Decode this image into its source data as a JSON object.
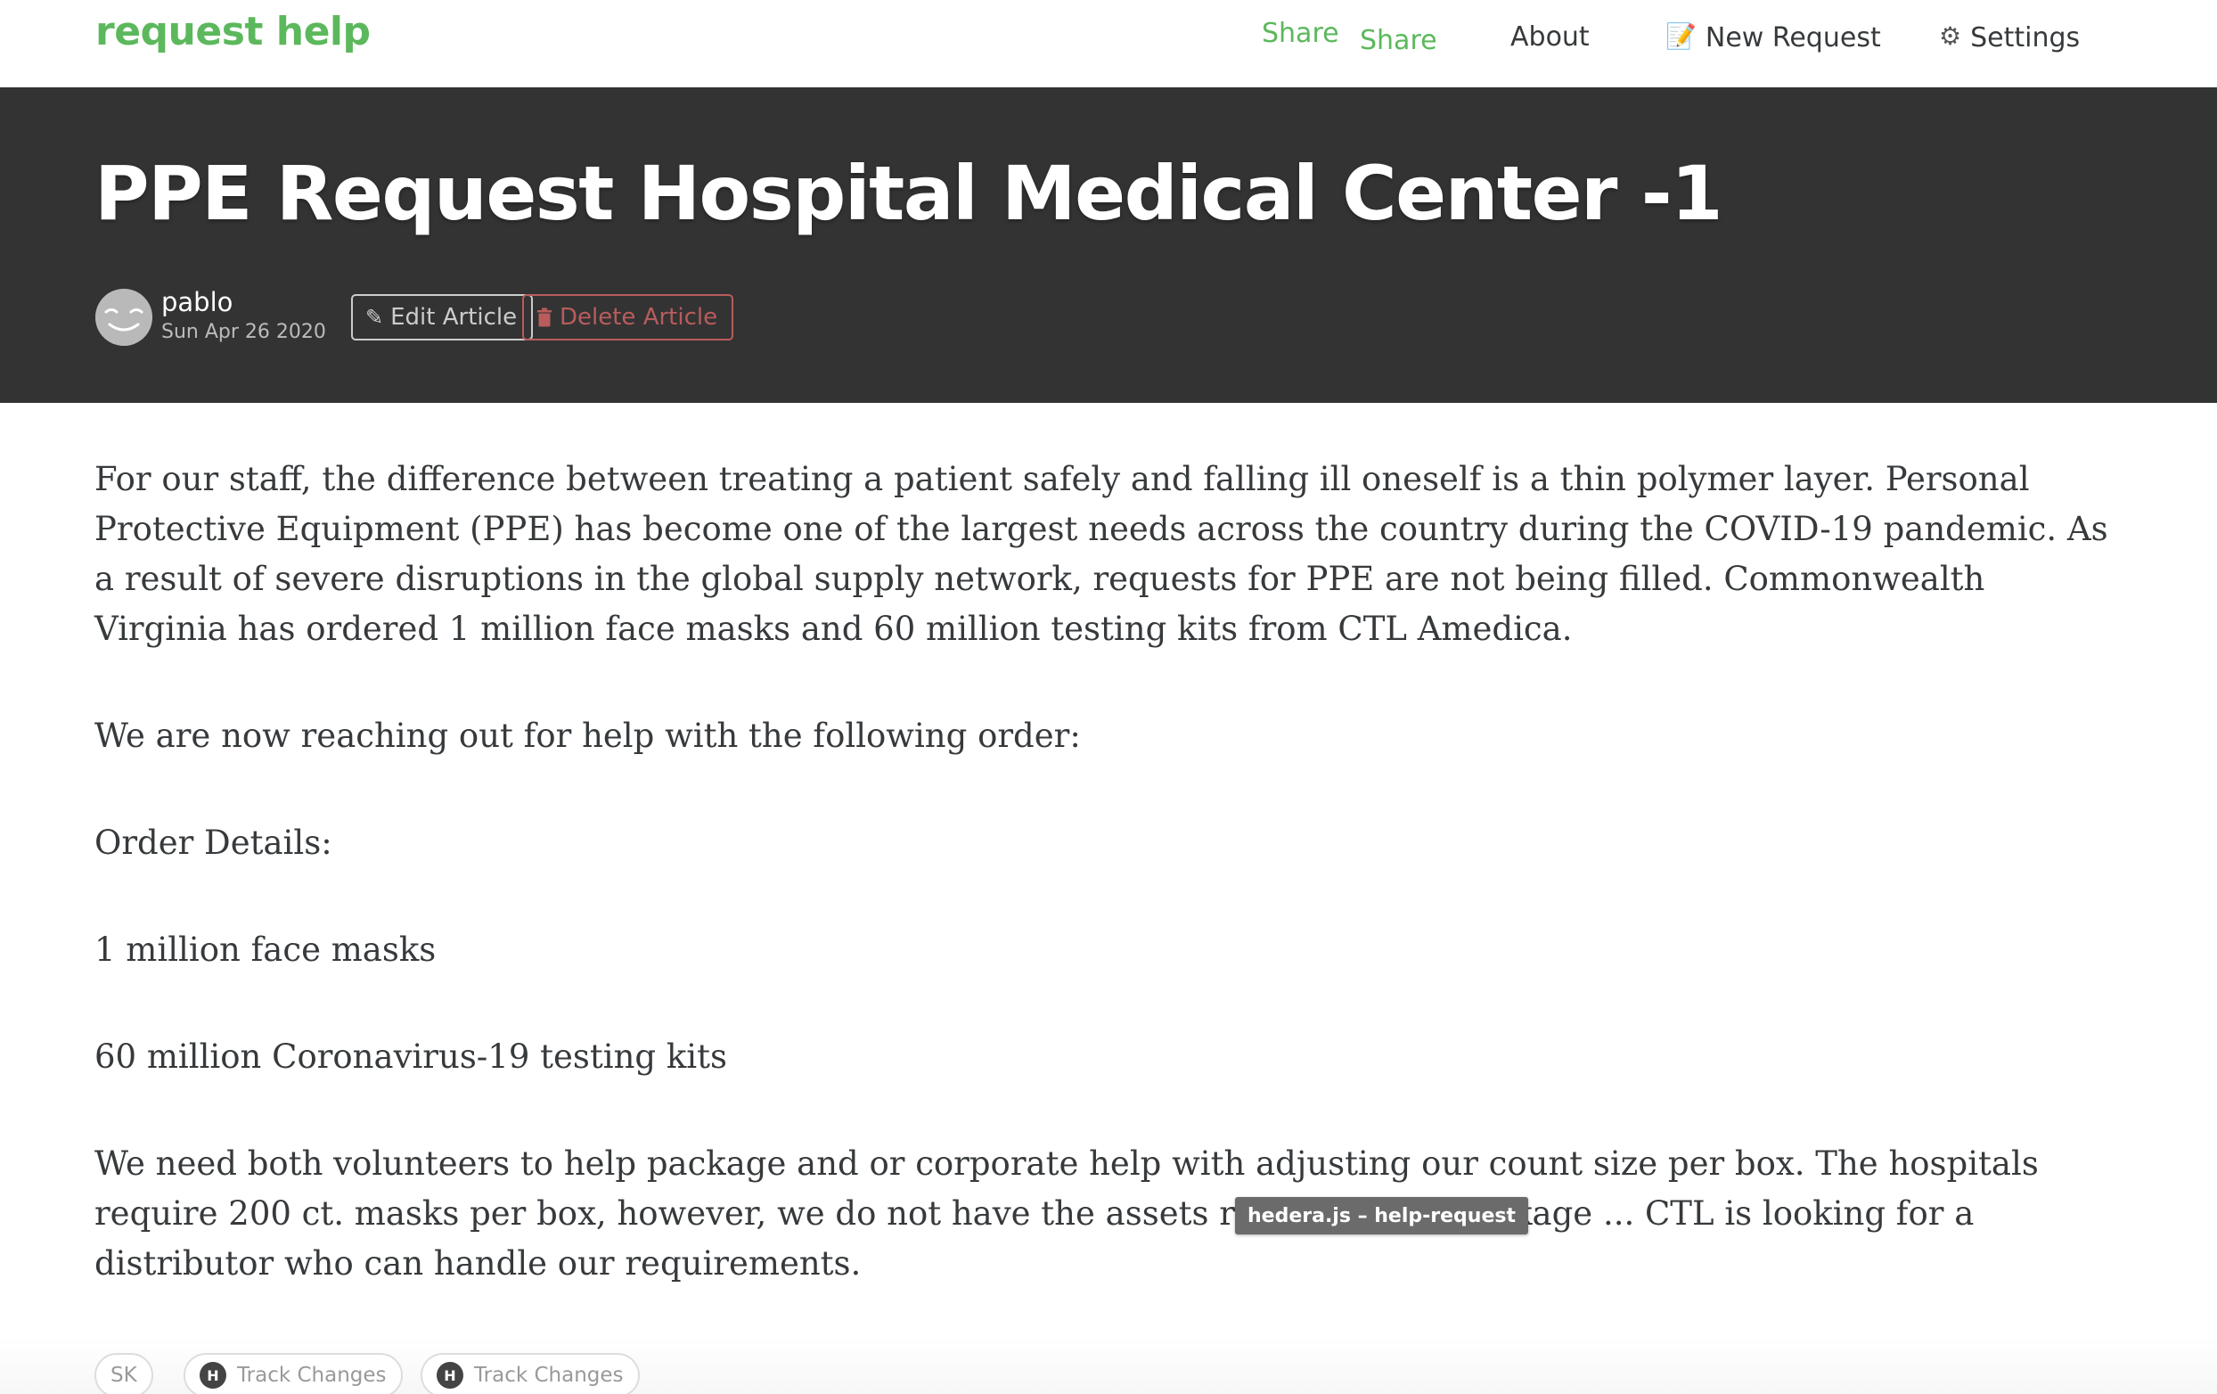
{
  "navbar": {
    "brand": "request help",
    "share_1": "Share",
    "share_2": "Share",
    "about": "About",
    "new_request": "New Request",
    "settings": "Settings",
    "new_request_icon": "memo-pencil-icon",
    "settings_icon": "gear-icon"
  },
  "article": {
    "title": "PPE Request Hospital Medical Center -1",
    "author": "pablo",
    "date": "Sun Apr 26 2020",
    "edit_label": "Edit Article",
    "delete_label": "Delete Article",
    "paragraphs": [
      "For our staff, the difference between treating a patient safely and falling ill oneself is a thin polymer layer. Personal Protective Equipment (PPE) has become one of the largest needs across the country during the COVID-19 pandemic. As a result of severe disruptions in the global supply network, requests for PPE are not being filled. Commonwealth Virginia has ordered 1 million face masks and 60 million testing kits from CTL Amedica.",
      "We are now reaching out for help with the following order:",
      "Order Details:",
      "1 million face masks",
      "60 million Coronavirus-19 testing kits",
      "We need both volunteers to help package and or corporate help with adjusting our count size per box. The hospitals require 200 ct. masks per box, however, we do not have the assets required to repackage ... CTL is looking for a distributor who can handle our requirements."
    ]
  },
  "tooltip": "hedera.js – help-request",
  "tags": {
    "sk": "SK",
    "track_1": "Track Changes",
    "track_2": "Track Changes",
    "badge_letter": "H"
  },
  "colors": {
    "brand": "#5cb85c",
    "banner_bg": "#333333",
    "danger": "#b85c5c"
  }
}
